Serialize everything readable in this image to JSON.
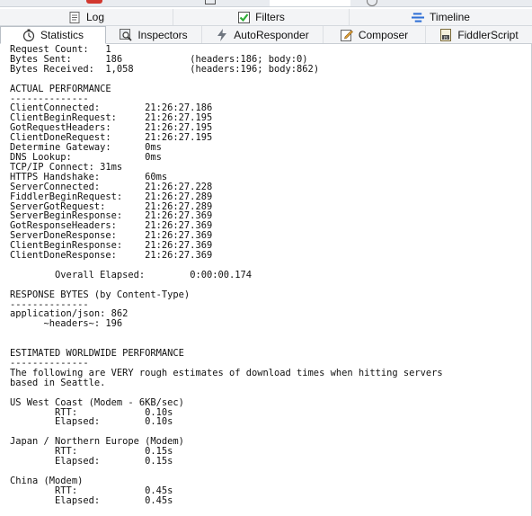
{
  "tabs_row1": [
    {
      "label": "Log",
      "icon": "log-icon"
    },
    {
      "label": "Filters",
      "icon": "checkbox-checked-icon"
    },
    {
      "label": "Timeline",
      "icon": "timeline-icon"
    }
  ],
  "tabs_row2": [
    {
      "label": "Statistics",
      "icon": "stopwatch-icon",
      "active": true
    },
    {
      "label": "Inspectors",
      "icon": "inspectors-icon"
    },
    {
      "label": "AutoResponder",
      "icon": "lightning-icon"
    },
    {
      "label": "Composer",
      "icon": "composer-icon"
    },
    {
      "label": "FiddlerScript",
      "icon": "fiddlerscript-icon"
    }
  ],
  "colors": {
    "accent_green": "#2fae38",
    "timeline_blue": "#2f6fd6",
    "lightning_gray": "#6f7680"
  },
  "stats_text": "Request Count:   1\nBytes Sent:      186\t\t(headers:186; body:0)\nBytes Received:  1,058\t\t(headers:196; body:862)\n\nACTUAL PERFORMANCE\n--------------\nClientConnected:\t21:26:27.186\nClientBeginRequest:\t21:26:27.195\nGotRequestHeaders:\t21:26:27.195\nClientDoneRequest:\t21:26:27.195\nDetermine Gateway:\t0ms\nDNS Lookup: \t\t0ms\nTCP/IP Connect:\t31ms\nHTTPS Handshake:\t60ms\nServerConnected:\t21:26:27.228\nFiddlerBeginRequest:\t21:26:27.289\nServerGotRequest:\t21:26:27.289\nServerBeginResponse:\t21:26:27.369\nGotResponseHeaders:\t21:26:27.369\nServerDoneResponse:\t21:26:27.369\nClientBeginResponse:\t21:26:27.369\nClientDoneResponse:\t21:26:27.369\n\n\tOverall Elapsed:\t0:00:00.174\n\nRESPONSE BYTES (by Content-Type)\n--------------\napplication/json: 862\n      ~headers~: 196\n\n\nESTIMATED WORLDWIDE PERFORMANCE\n--------------\nThe following are VERY rough estimates of download times when hitting servers\nbased in Seattle.\n\nUS West Coast (Modem - 6KB/sec)\n\tRTT:\t\t0.10s\n\tElapsed:\t0.10s\n\nJapan / Northern Europe (Modem)\n\tRTT:\t\t0.15s\n\tElapsed:\t0.15s\n\nChina (Modem)\n\tRTT:\t\t0.45s\n\tElapsed:\t0.45s"
}
